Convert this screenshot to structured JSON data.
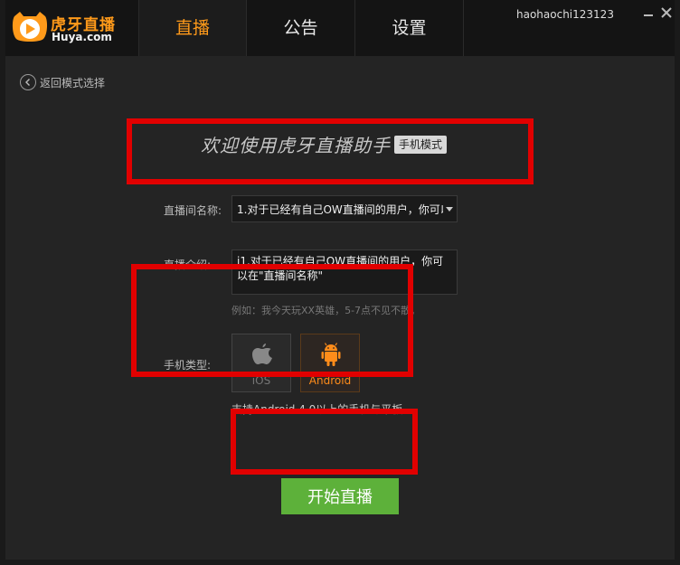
{
  "app": {
    "logo_name": "虎牙直播",
    "logo_domain": "Huya.com",
    "username": "haohaochi123123"
  },
  "tabs": [
    {
      "label": "直播",
      "active": true
    },
    {
      "label": "公告",
      "active": false
    },
    {
      "label": "设置",
      "active": false
    }
  ],
  "back": {
    "label": "返回模式选择"
  },
  "welcome": {
    "title": "欢迎使用虎牙直播助手",
    "mode_badge": "手机模式"
  },
  "form": {
    "room_name_label": "直播间名称:",
    "room_name_value": "1.对于已经有自己OW直播间的用户，你可以",
    "intro_label": "直播介绍:",
    "intro_value": "j1.对于已经有自己OW直播间的用户，你可以在\"直播间名称\"",
    "example_hint": "例如：我今天玩XX英雄，5-7点不见不散。",
    "phone_type_label": "手机类型:",
    "phone_options": [
      {
        "label": "iOS",
        "selected": false
      },
      {
        "label": "Android",
        "selected": true
      }
    ],
    "support_text": "支持Android 4.0以上的手机与平板"
  },
  "actions": {
    "start_label": "开始直播"
  },
  "colors": {
    "accent_orange": "#ff9a1a",
    "start_green": "#5db13a",
    "highlight_red": "#e10000",
    "header_bg": "#141414",
    "main_bg": "#242424"
  }
}
